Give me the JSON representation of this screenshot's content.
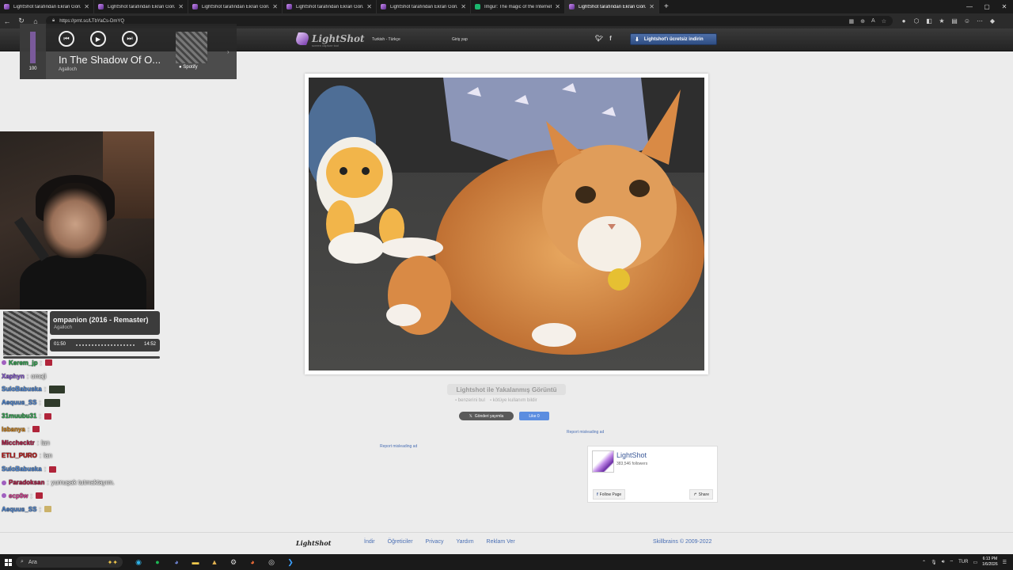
{
  "browser": {
    "tabs": [
      {
        "title": "LightShot tarafından Ekran Görüntü",
        "icon": "lightshot-feather-icon",
        "active": false
      },
      {
        "title": "LightShot tarafından Ekran Görüntü",
        "icon": "lightshot-feather-icon",
        "active": false
      },
      {
        "title": "LightShot tarafından Ekran Görüntü",
        "icon": "lightshot-feather-icon",
        "active": false
      },
      {
        "title": "LightShot tarafından Ekran Görüntü",
        "icon": "lightshot-feather-icon",
        "active": false
      },
      {
        "title": "LightShot tarafından Ekran Görüntü",
        "icon": "lightshot-feather-icon",
        "active": false
      },
      {
        "title": "Imgur: The magic of the Internet",
        "icon": "imgur-icon",
        "active": false
      },
      {
        "title": "LightShot tarafından Ekran Görüntü",
        "icon": "lightshot-feather-icon",
        "active": true
      }
    ],
    "url": "https://prnt.sc/LTbYaCs-DmYQ"
  },
  "lightshot": {
    "logo_text": "LightShot",
    "tagline": "screen capture tool",
    "language": "Turkish - Türkçe",
    "login": "Giriş yap",
    "download_button": "Lightshot'ı ücretsiz indirin",
    "caption": "Lightshot ile Yakalanmış Görüntü",
    "find_similar": "benzerini bul",
    "report_abuse": "kötüye kullanım bildir",
    "tweet_button": "Gönderi yayımla",
    "like_button": "Like 0",
    "report_ad_1": "Report misleading ad",
    "report_ad_2": "Report misleading ad",
    "fb": {
      "name": "LightShot",
      "followers": "383,546 followers",
      "follow": "Follow Page",
      "share": "Share"
    },
    "footer": {
      "logo": "LightShot",
      "links": [
        "İndir",
        "Öğreticiler",
        "Privacy",
        "Yardım",
        "Reklam Ver"
      ],
      "copyright": "Skillbrains © 2009-2022"
    }
  },
  "spotify_widget": {
    "volume": "100",
    "volume_level": 1.0,
    "title": "In The Shadow Of O...",
    "artist": "Agalloch",
    "brand": "Spotify"
  },
  "now_playing": {
    "track": "ompanion (2016 - Remaster)",
    "artist": "Agalloch",
    "current_time": "01:50",
    "duration": "14:52",
    "progress": 0.123
  },
  "chat": [
    {
      "user": "Kerem_jp",
      "text": "",
      "color": "#2fa84f",
      "emote": "red",
      "badge": true
    },
    {
      "user": "Xaphyn",
      "text": "omaji",
      "color": "#8a5cd6",
      "emote": "",
      "badge": false
    },
    {
      "user": "SuloBabuska",
      "text": "",
      "color": "#4f8ad9",
      "emote": "wide",
      "badge": false
    },
    {
      "user": "Aequus_SS",
      "text": "",
      "color": "#4f8ad9",
      "emote": "wide",
      "badge": false
    },
    {
      "user": "31muubu31",
      "text": "",
      "color": "#2fa84f",
      "emote": "red",
      "badge": false
    },
    {
      "user": "Isbanya",
      "text": "",
      "color": "#d98a1f",
      "emote": "red",
      "badge": false
    },
    {
      "user": "Micchecktr",
      "text": "lan",
      "color": "#b81f4a",
      "emote": "",
      "badge": false
    },
    {
      "user": "ETLI_PURO",
      "text": "lan",
      "color": "#c21818",
      "emote": "",
      "badge": false
    },
    {
      "user": "SuloBabuska",
      "text": "",
      "color": "#4f8ad9",
      "emote": "red",
      "badge": false
    },
    {
      "user": "Paradoksan",
      "text": "yumuşak tutmaktayım.",
      "color": "#b81f4a",
      "emote": "",
      "badge": true
    },
    {
      "user": "ecp0w",
      "text": "",
      "color": "#e0409a",
      "emote": "red",
      "badge": true
    },
    {
      "user": "Aequus_SS",
      "text": "",
      "color": "#4f8ad9",
      "emote": "cheer",
      "badge": false
    }
  ],
  "taskbar": {
    "search_placeholder": "Ara",
    "language": "TUR",
    "time": "6:13 PM",
    "date": "1/6/2026"
  }
}
